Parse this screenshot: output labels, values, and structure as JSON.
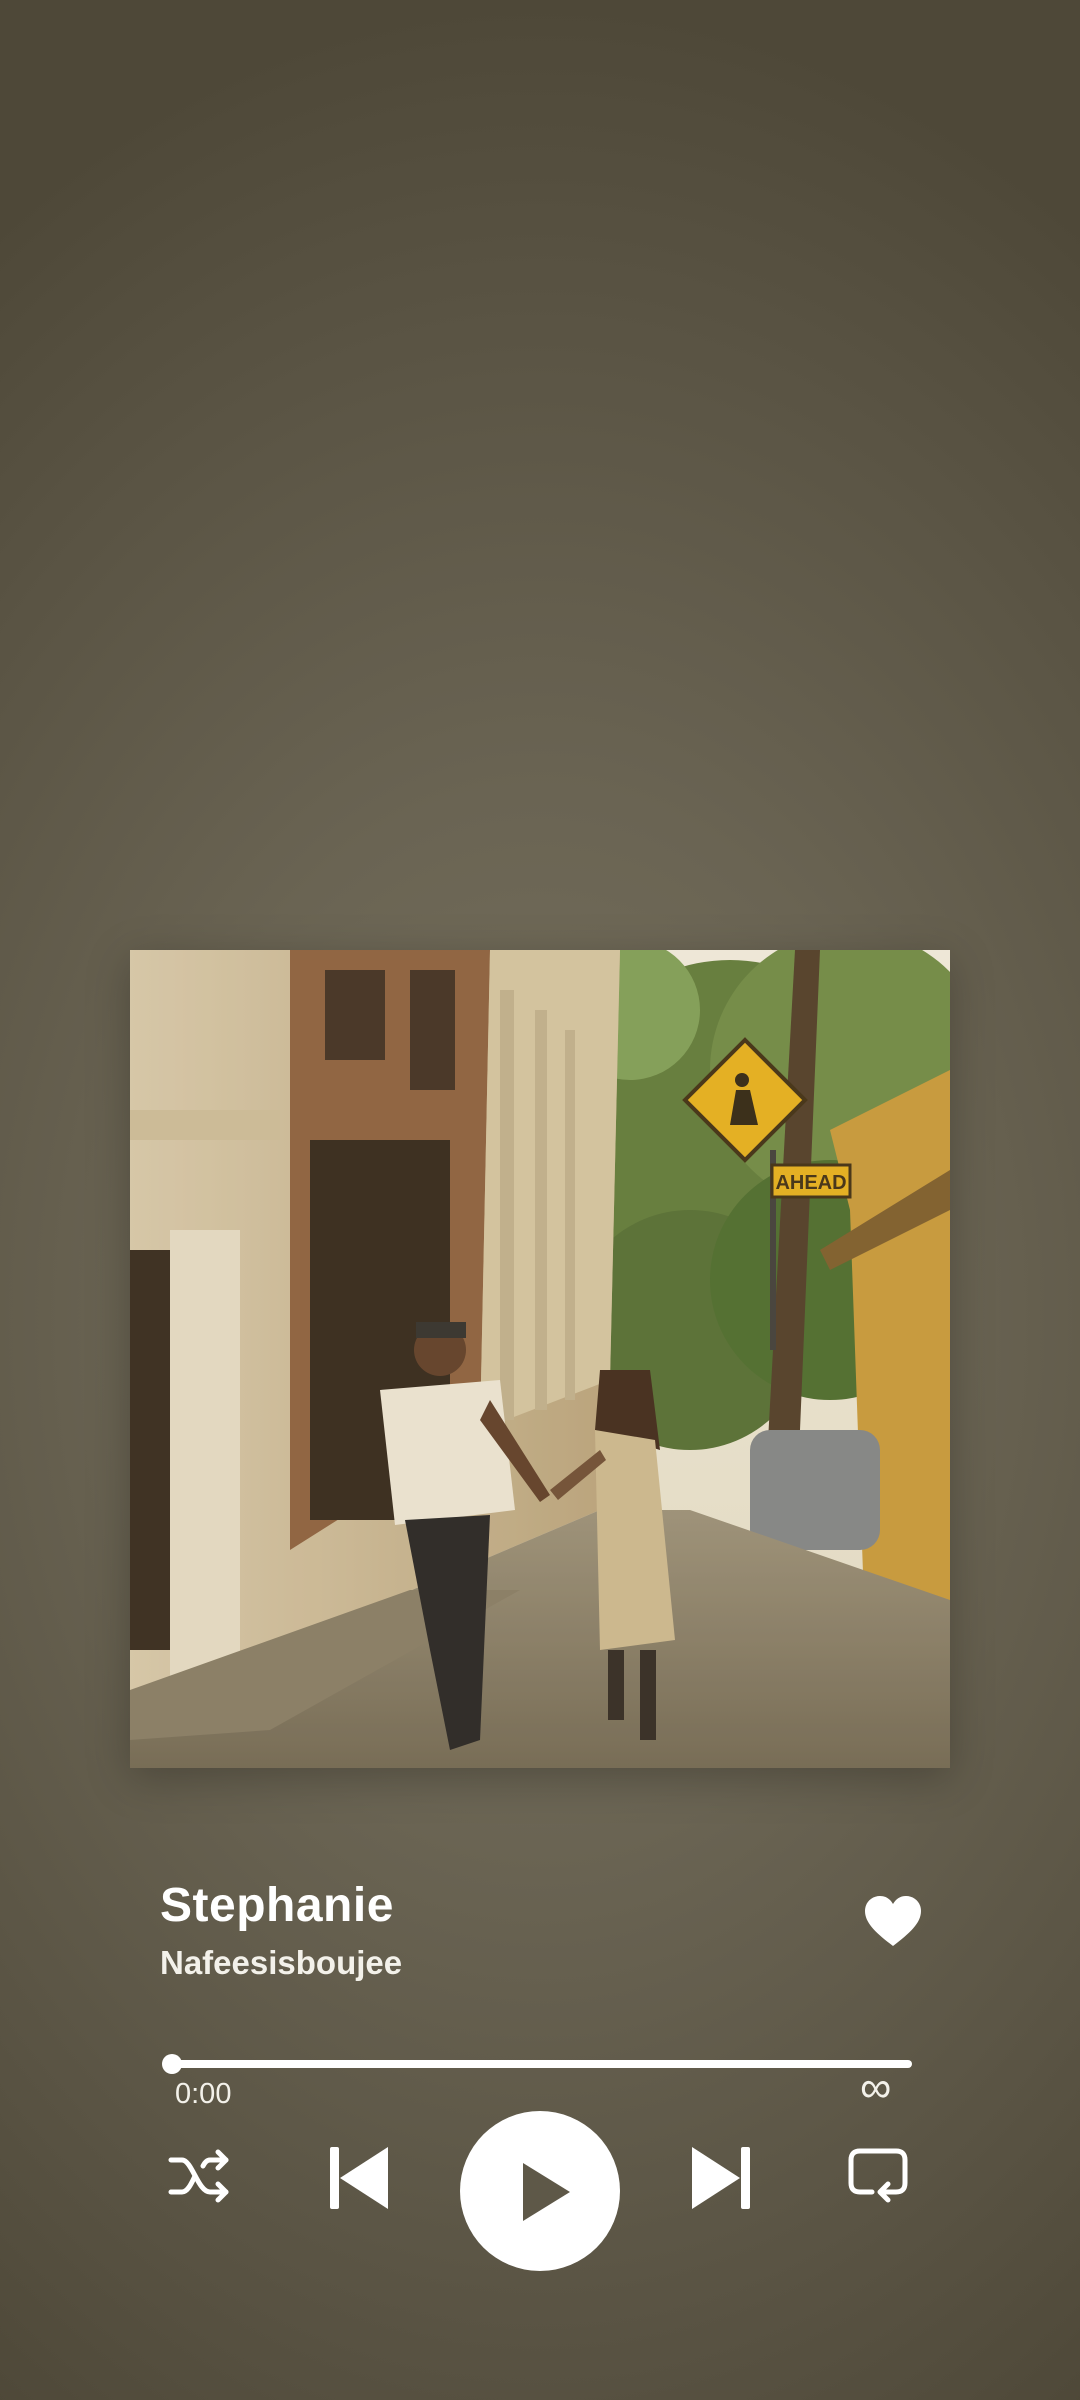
{
  "track": {
    "title": "Stephanie",
    "artist": "Nafeesisboujee",
    "liked": true
  },
  "artwork": {
    "sign_text": "AHEAD"
  },
  "progress": {
    "elapsed": "0:00",
    "total": "∞",
    "fraction": 0.0
  },
  "controls": {
    "shuffle": "shuffle-icon",
    "previous": "skip-previous-icon",
    "play": "play-icon",
    "next": "skip-next-icon",
    "repeat": "repeat-icon"
  },
  "colors": {
    "background": "#6a6453",
    "foreground": "#ffffff",
    "play_icon": "#5e5848"
  }
}
